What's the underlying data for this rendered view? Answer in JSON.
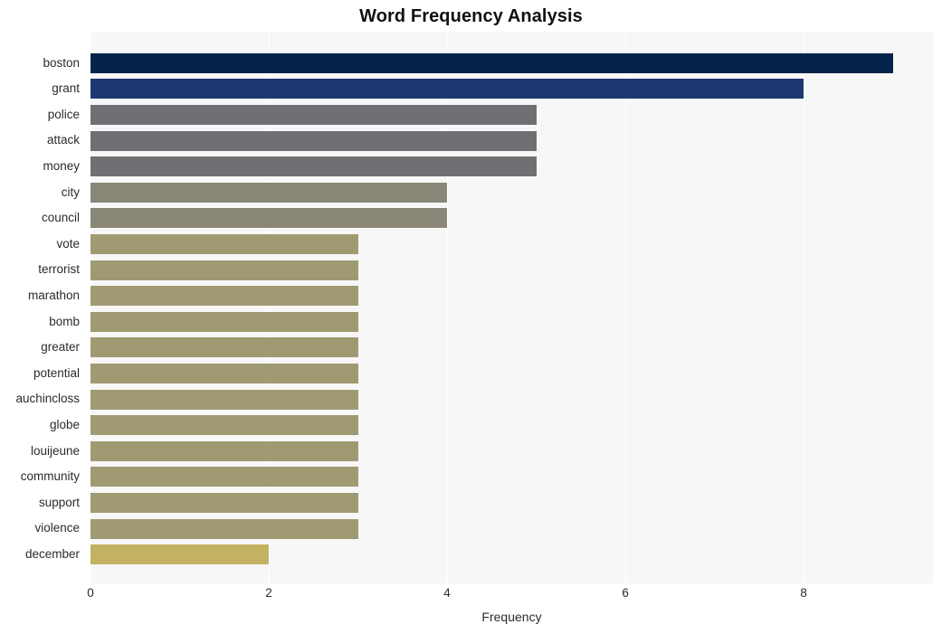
{
  "chart_data": {
    "type": "bar",
    "orientation": "horizontal",
    "title": "Word Frequency Analysis",
    "xlabel": "Frequency",
    "ylabel": "",
    "xlim": [
      0,
      9.45
    ],
    "xticks": [
      0,
      2,
      4,
      6,
      8
    ],
    "grid": true,
    "legend": false,
    "categories": [
      "boston",
      "grant",
      "police",
      "attack",
      "money",
      "city",
      "council",
      "vote",
      "terrorist",
      "marathon",
      "bomb",
      "greater",
      "potential",
      "auchincloss",
      "globe",
      "louijeune",
      "community",
      "support",
      "violence",
      "december"
    ],
    "values": [
      9,
      8,
      5,
      5,
      5,
      4,
      4,
      3,
      3,
      3,
      3,
      3,
      3,
      3,
      3,
      3,
      3,
      3,
      3,
      2
    ],
    "bar_colors": [
      "#04244c",
      "#1b3870",
      "#6e7073",
      "#6e7073",
      "#6e7073",
      "#8a8778",
      "#8a8778",
      "#a09a73",
      "#a09a73",
      "#a09a73",
      "#a09a73",
      "#a09a73",
      "#a09a73",
      "#a09a73",
      "#a09a73",
      "#a09a73",
      "#a09a73",
      "#a09a73",
      "#a09a73",
      "#c4b263"
    ],
    "plot_background": "#f7f7f7",
    "figure_background": "#ffffff",
    "gridline_color": "#ffffff"
  }
}
